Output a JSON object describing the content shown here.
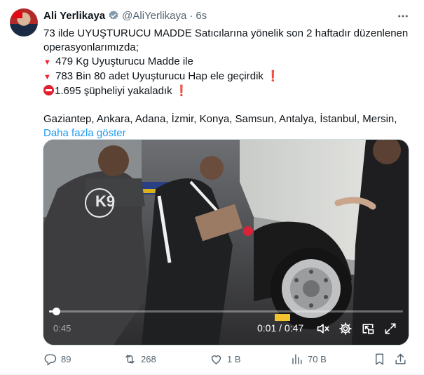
{
  "tweet": {
    "author_name": "Ali Yerlikaya",
    "handle": "@AliYerlikaya",
    "separator": "·",
    "time": "6s",
    "lines": [
      "73 ilde UYUŞTURUCU MADDE Satıcılarına yönelik son 2 haftadır düzenlenen",
      "operasyonlarımızda;",
      "479 Kg Uyuşturucu Madde ile",
      "783 Bin 80 adet Uyuşturucu Hap ele geçirdik",
      "1.695 şüpheliyi yakaladık",
      "",
      "Gaziantep, Ankara, Adana, İzmir, Konya, Samsun, Antalya, İstanbul, Mersin,"
    ],
    "show_more": "Daha fazla göster"
  },
  "video": {
    "elapsed_overlay": "0:45",
    "timestamp": "0:01 / 0:47",
    "progress": 0.02,
    "shirt_text": "K9"
  },
  "actions": {
    "replies": "89",
    "retweets": "268",
    "likes": "1 B",
    "views": "70 B"
  },
  "colors": {
    "accent": "#1d9bf0",
    "alert_red": "#f4212e",
    "muted": "#536471"
  },
  "icons": {
    "verified": "verified-badge-icon",
    "more": "more-options-icon",
    "reply": "reply-icon",
    "retweet": "retweet-icon",
    "like": "heart-icon",
    "views": "views-icon",
    "bookmark": "bookmark-icon",
    "share": "share-icon"
  }
}
